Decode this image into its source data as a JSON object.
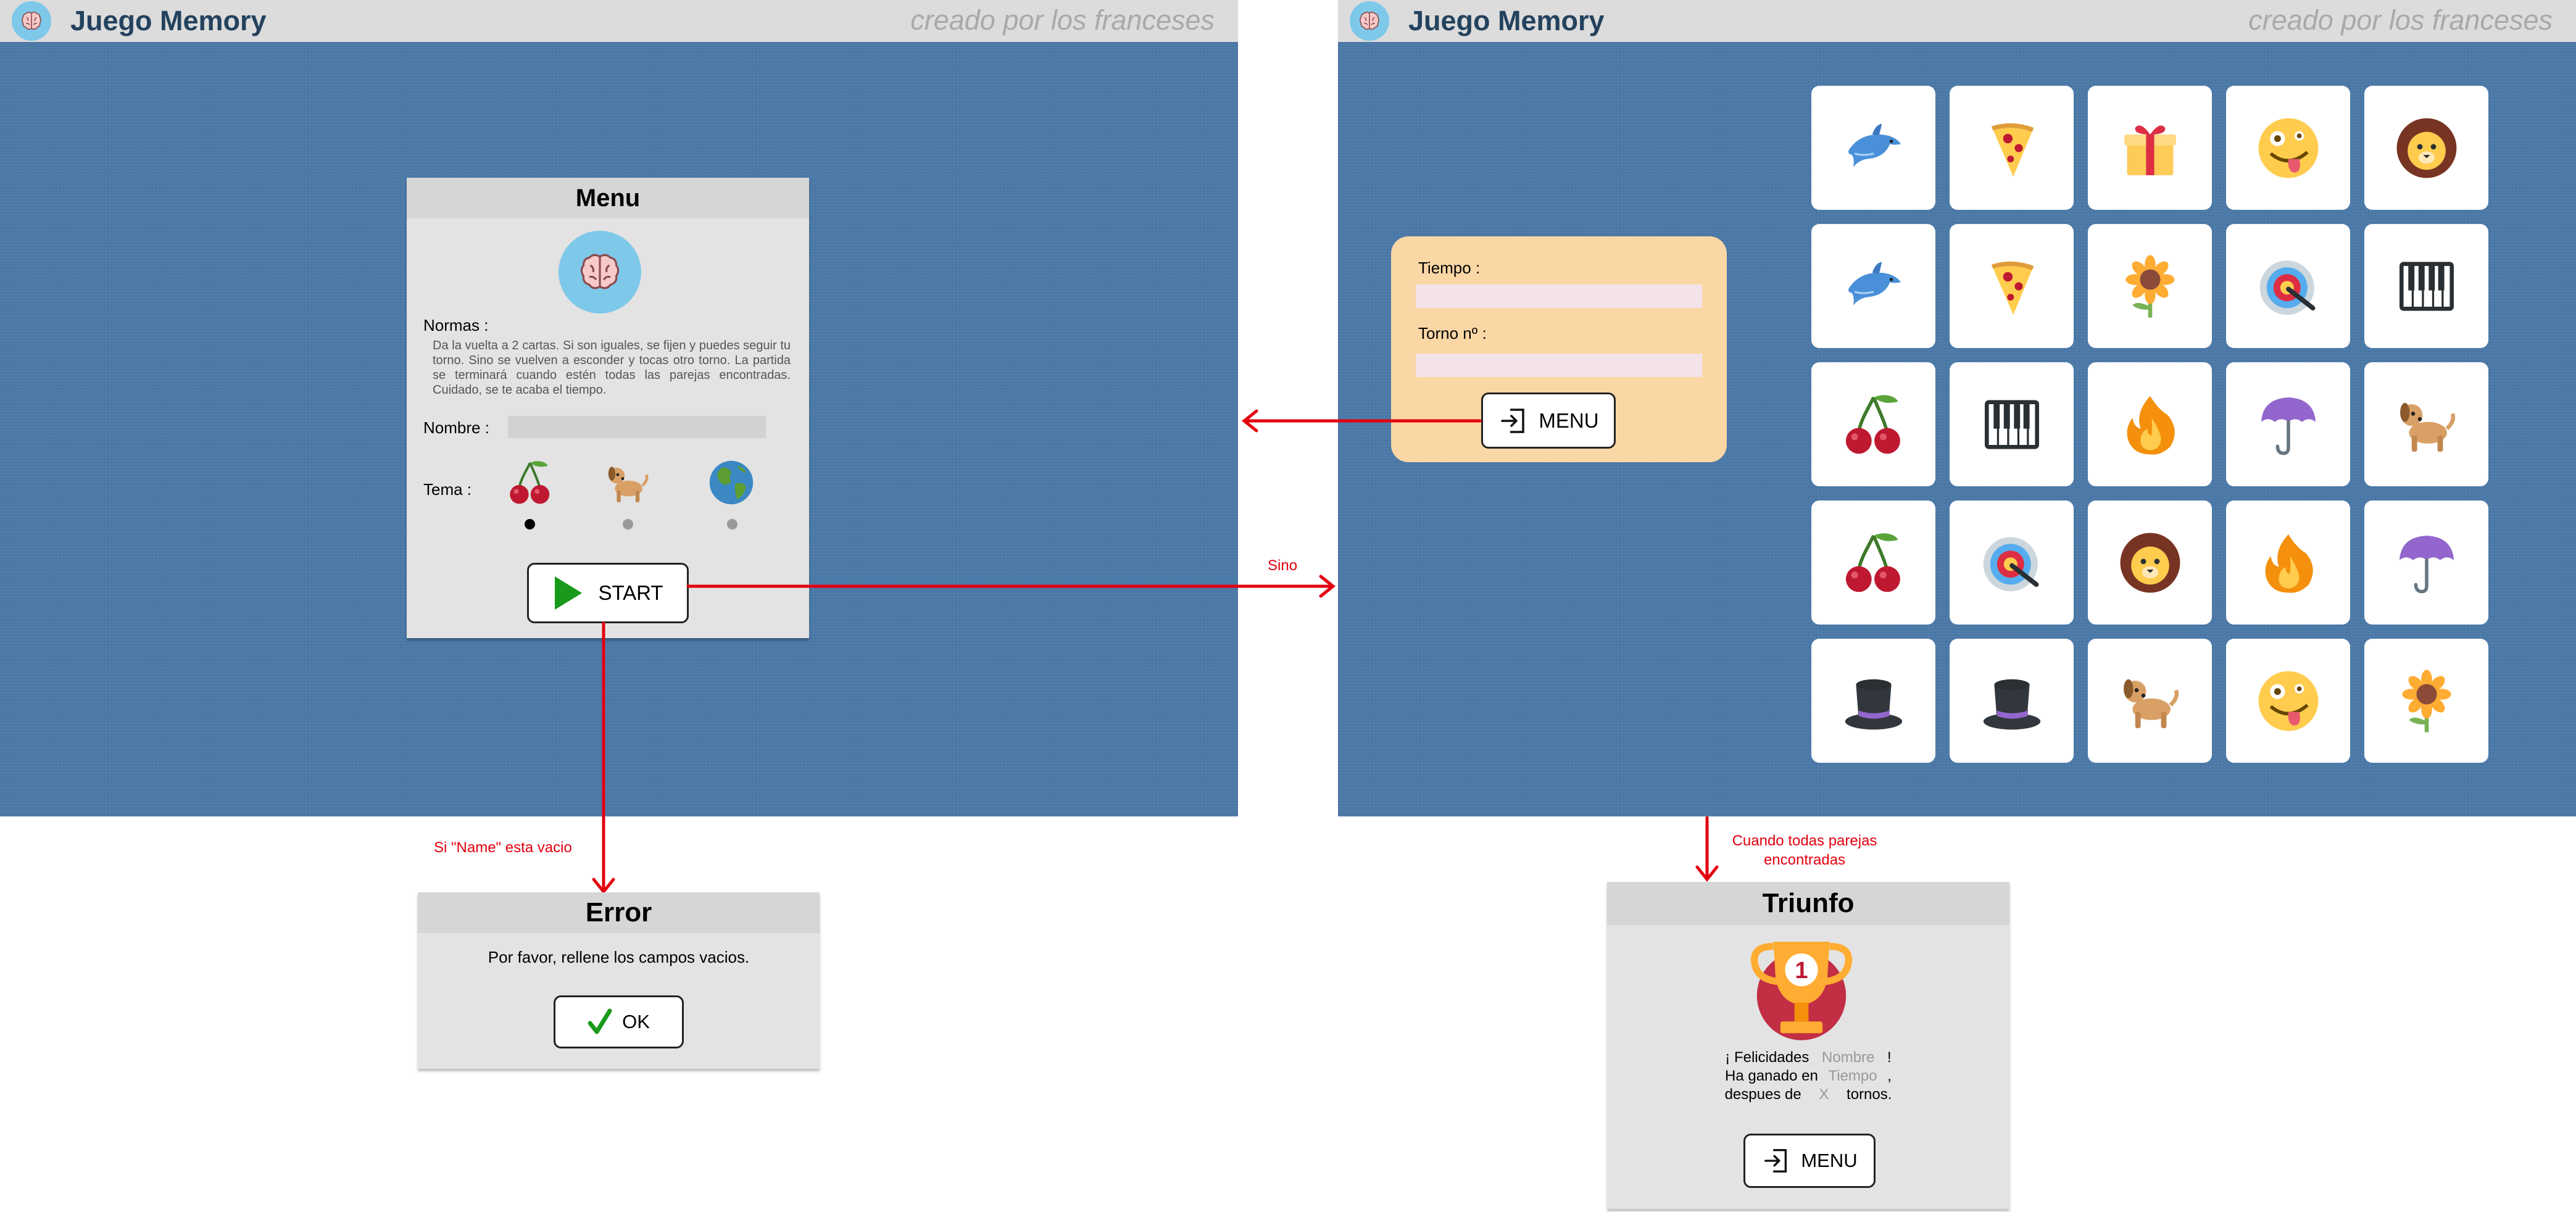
{
  "app": {
    "title": "Juego Memory",
    "subtitle": "creado por los franceses"
  },
  "menu": {
    "title": "Menu",
    "rules_label": "Normas :",
    "rules_text": "Da la vuelta a 2 cartas. Si son iguales, se fijen y puedes seguir tu torno. Sino se vuelven a esconder y tocas otro torno. La partida se terminará cuando estén todas las parejas encontradas. Cuidado, se te acaba el tiempo.",
    "name_label": "Nombre :",
    "name_value": "",
    "theme_label": "Tema :",
    "themes": [
      {
        "icon": "cherries-icon",
        "selected": true
      },
      {
        "icon": "dog-icon",
        "selected": false
      },
      {
        "icon": "globe-icon",
        "selected": false
      }
    ],
    "start_label": "START"
  },
  "game": {
    "time_label": "Tiempo :",
    "time_value": "",
    "turn_label": "Torno nº :",
    "turn_value": "",
    "menu_label": "MENU",
    "board": [
      [
        "dolphin-icon",
        "pizza-icon",
        "gift-icon",
        "zany-face-icon",
        "lion-icon"
      ],
      [
        "dolphin-icon",
        "pizza-icon",
        "sunflower-icon",
        "target-icon",
        "piano-icon"
      ],
      [
        "cherries-icon",
        "piano-icon",
        "fire-icon",
        "umbrella-icon",
        "dog-icon"
      ],
      [
        "cherries-icon",
        "target-icon",
        "lion-icon",
        "fire-icon",
        "umbrella-icon"
      ],
      [
        "top-hat-icon",
        "top-hat-icon",
        "dog-icon",
        "zany-face-icon",
        "sunflower-icon"
      ]
    ]
  },
  "error": {
    "title": "Error",
    "message": "Por favor, rellene los campos vacios.",
    "ok_label": "OK"
  },
  "triunfo": {
    "title": "Triunfo",
    "line1_pre": "¡ Felicidades",
    "line1_var": "Nombre",
    "line1_post": "!",
    "line2_pre": "Ha ganado en",
    "line2_var": "Tiempo",
    "line2_post": ",",
    "line3_pre": "despues de",
    "line3_var": "X",
    "line3_post": "tornos.",
    "menu_label": "MENU"
  },
  "flow": {
    "sino": "Sino",
    "si_vacio": "Si \"Name\" esta vacio",
    "cuando": "Cuando todas parejas encontradas"
  },
  "colors": {
    "background": "#4b79a8",
    "topbar": "#dcdcdc",
    "title": "#23425e",
    "panel": "#fbd7a5",
    "arrow": "#e3000f",
    "play": "#1a9a1a"
  }
}
